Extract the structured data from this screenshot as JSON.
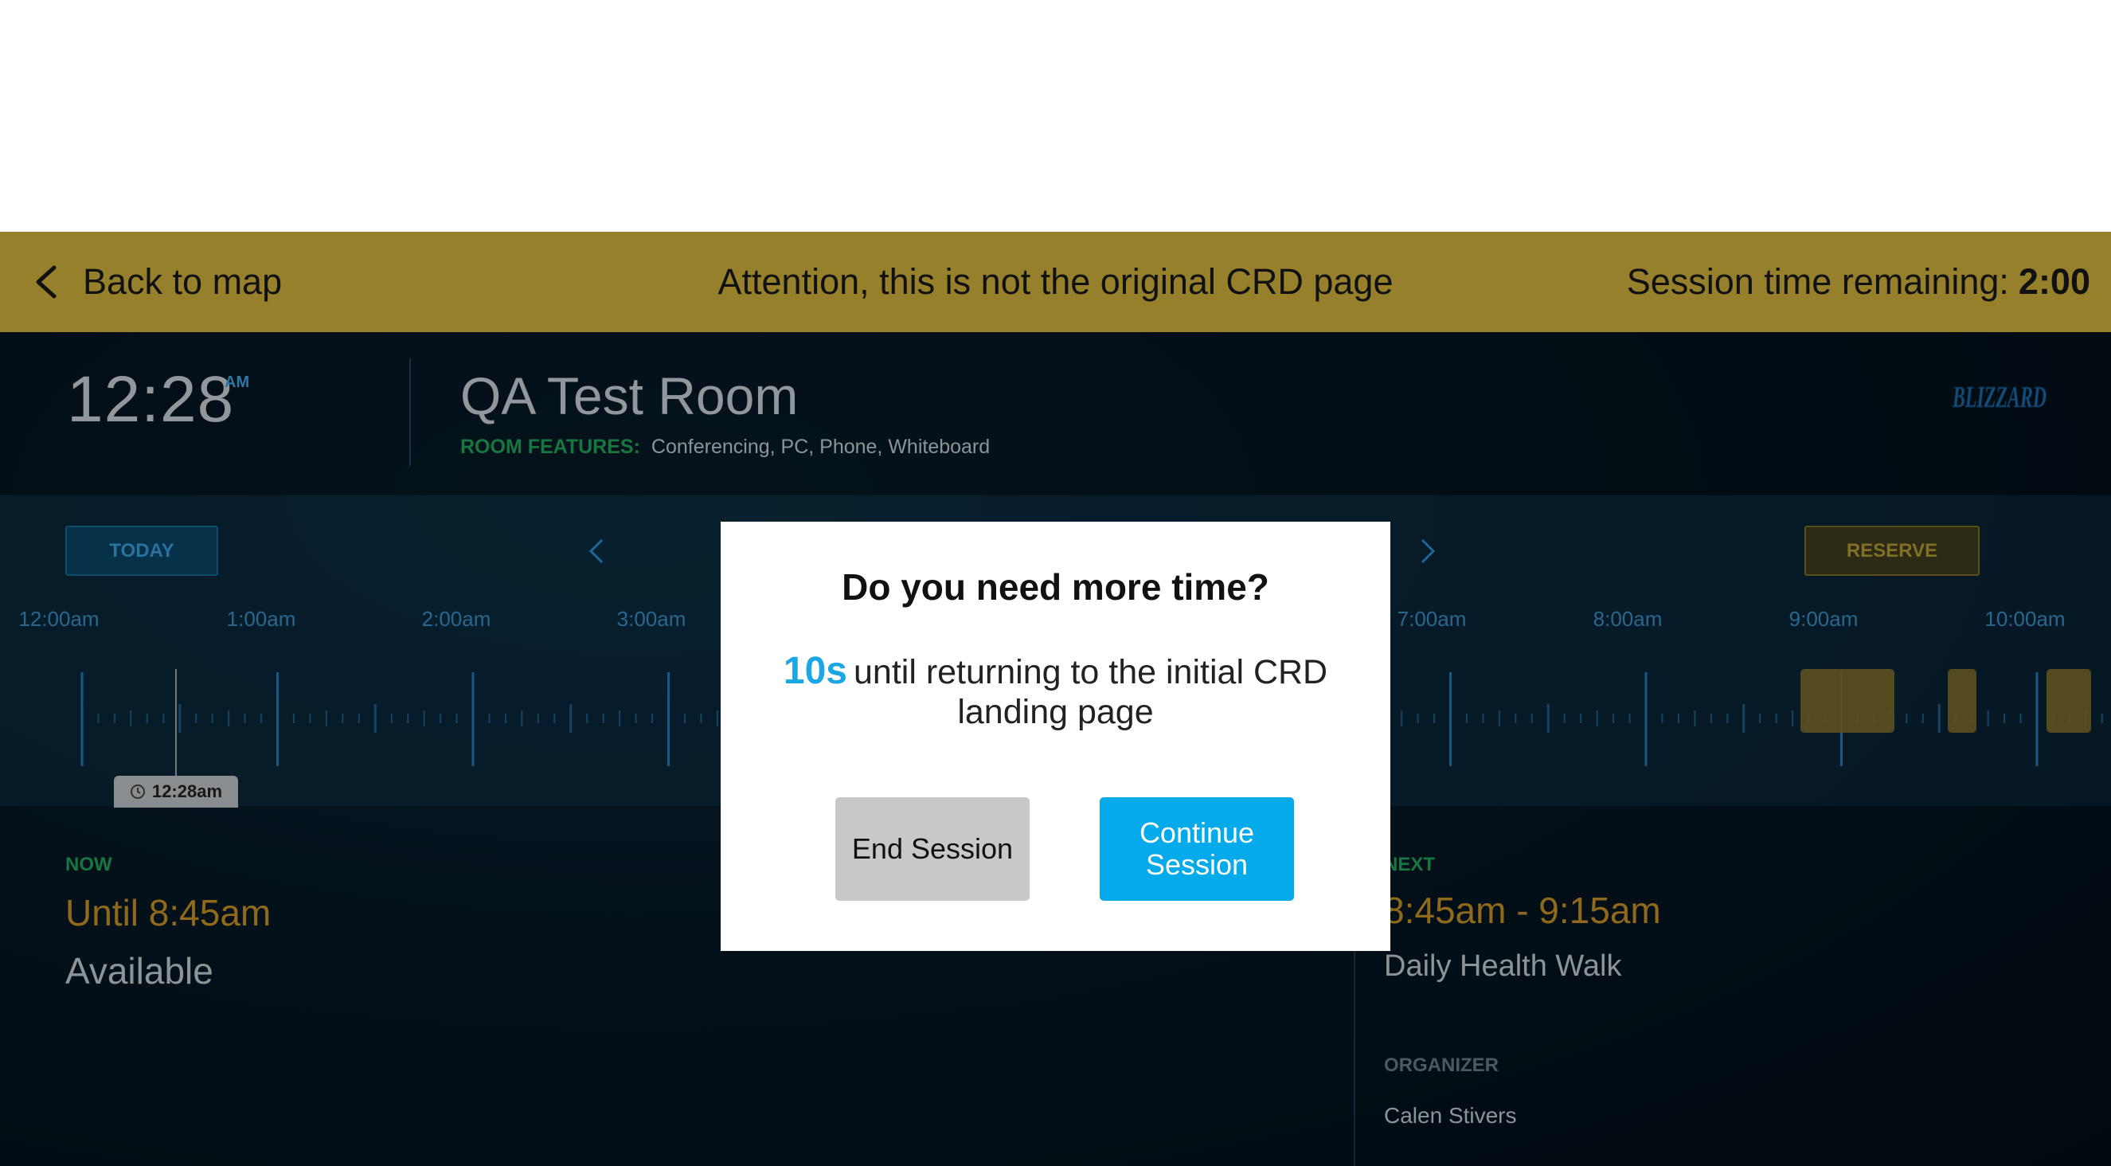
{
  "banner": {
    "back_label": "Back to map",
    "title": "Attention, this is not the original CRD page",
    "session_label": "Session time remaining:",
    "session_value": "2:00",
    "color": "#96802c"
  },
  "header": {
    "clock": "12:28",
    "ampm": "AM",
    "room_name": "QA Test Room",
    "features_label": "ROOM FEATURES:",
    "features_value": "Conferencing, PC, Phone, Whiteboard",
    "logo_text": "BLIZZARD"
  },
  "timeline": {
    "today_label": "TODAY",
    "reserve_label": "RESERVE",
    "hour_labels": [
      "12:00am",
      "1:00am",
      "2:00am",
      "3:00am",
      "7:00am",
      "8:00am",
      "9:00am",
      "10:00am"
    ],
    "now_badge": "12:28am"
  },
  "now": {
    "label": "NOW",
    "until": "Until 8:45am",
    "status": "Available"
  },
  "next": {
    "label": "NEXT",
    "time": "8:45am - 9:15am",
    "title": "Daily Health Walk",
    "organizer_label": "ORGANIZER",
    "organizer_name": "Calen Stivers"
  },
  "modal": {
    "title": "Do you need more time?",
    "countdown": "10s",
    "message": "until returning to the initial CRD landing page",
    "end_label": "End Session",
    "continue_label": "Continue Session"
  },
  "colors": {
    "accent_blue": "#05aaea",
    "available_green": "#20a55a",
    "event_gold": "#c89428"
  }
}
